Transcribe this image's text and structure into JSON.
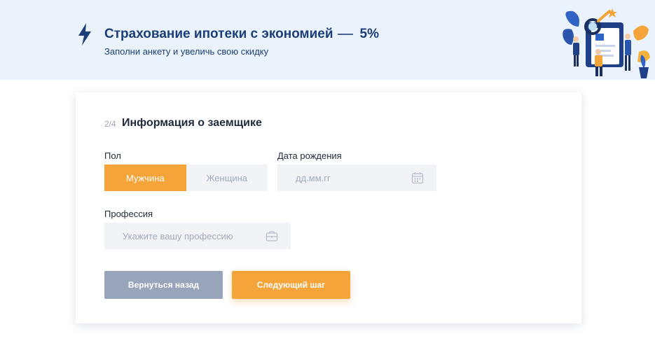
{
  "hero": {
    "title": "Страхование ипотеки с экономией",
    "discount": "5%",
    "subtitle": "Заполни анкету и увеличь свою скидку",
    "accent_color": "#1c3e78"
  },
  "form": {
    "step": "2/4",
    "title": "Информация о заемщике",
    "gender": {
      "label": "Пол",
      "options": [
        "Мужчина",
        "Женщина"
      ],
      "selected": "Мужчина"
    },
    "birthdate": {
      "label": "Дата рождения",
      "placeholder": "дд.мм.гг",
      "value": "",
      "icon": "calendar-icon"
    },
    "profession": {
      "label": "Профессия",
      "placeholder": "Укажите вашу профессию",
      "value": "",
      "icon": "briefcase-icon"
    },
    "buttons": {
      "back_label": "Вернуться назад",
      "next_label": "Следующий шаг"
    }
  },
  "colors": {
    "primary_orange": "#f5a43a",
    "muted_button": "#97a4ba",
    "hero_bg": "#eaf2fc"
  }
}
